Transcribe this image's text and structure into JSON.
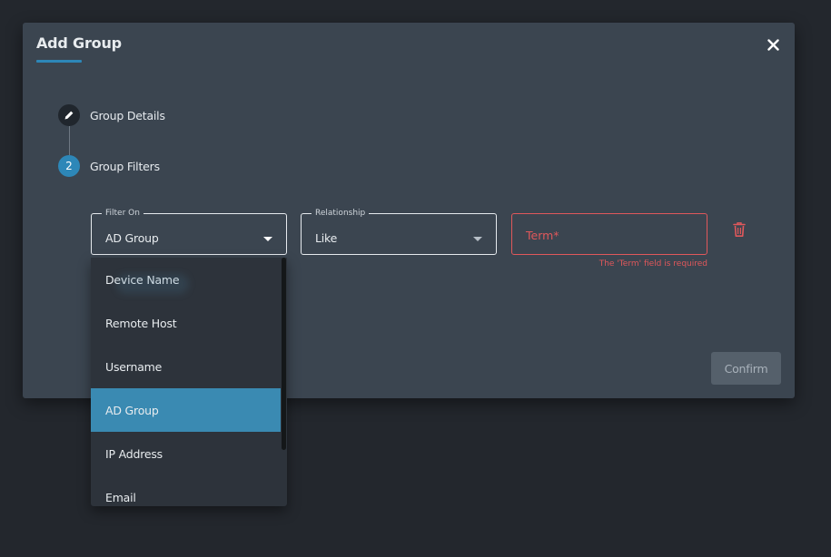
{
  "dialog": {
    "title": "Add Group",
    "close_icon": "close-icon"
  },
  "steps": [
    {
      "label": "Group Details",
      "indicator_icon": "pencil-icon"
    },
    {
      "label": "Group Filters",
      "number": "2"
    }
  ],
  "filter": {
    "filter_on": {
      "legend": "Filter On",
      "value": "AD Group"
    },
    "relationship": {
      "legend": "Relationship",
      "value": "Like"
    },
    "term": {
      "placeholder": "Term*",
      "error": "The 'Term' field is required"
    },
    "delete_icon": "trash-icon"
  },
  "dropdown": {
    "options": [
      "Device Name",
      "Remote Host",
      "Username",
      "AD Group",
      "IP Address",
      "Email"
    ],
    "selected": "AD Group"
  },
  "actions": {
    "confirm_label": "Confirm"
  },
  "colors": {
    "accent": "#2d87b8",
    "selected_option": "#3a8ab2",
    "error": "#e0585b",
    "dialog_bg": "#3b4550",
    "page_bg": "#23272d"
  }
}
